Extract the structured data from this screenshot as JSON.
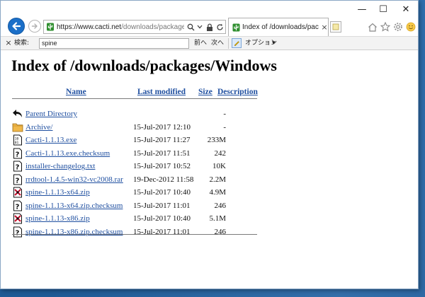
{
  "browser": {
    "window_controls": {
      "minimize": "—",
      "maximize": "☐",
      "close": "✕"
    },
    "address_bar": {
      "url_prefix": "https://www.cacti.net",
      "url_rest": "/downloads/packages/Wind",
      "search_icon": "search-icon",
      "dropdown_icon": "chevron-down-icon",
      "lock_icon": "lock-icon",
      "refresh_icon": "refresh-icon"
    },
    "tab": {
      "title": "Index of /downloads/packa...",
      "close": "×"
    },
    "toolbar_icons": [
      "home-icon",
      "star-icon",
      "gear-icon",
      "smiley-icon"
    ],
    "find_bar": {
      "close": "×",
      "label": "検索:",
      "value": "spine",
      "prev": "前へ",
      "next": "次へ",
      "options": "オプション",
      "options_arrow": "▾"
    }
  },
  "page": {
    "title": "Index of /downloads/packages/Windows",
    "columns": {
      "name": "Name",
      "modified": "Last modified",
      "size": "Size",
      "description": "Description"
    },
    "rows": [
      {
        "icon": "back-arrow-icon",
        "name": "Parent Directory",
        "date": "",
        "size": "-"
      },
      {
        "icon": "folder-icon",
        "name": "Archive/",
        "date": "15-Jul-2017 12:10",
        "size": "-"
      },
      {
        "icon": "binary-file-icon",
        "name": "Cacti-1.1.13.exe",
        "date": "15-Jul-2017 11:27",
        "size": "233M"
      },
      {
        "icon": "unknown-file-icon",
        "name": "Cacti-1.1.13.exe.checksum",
        "date": "15-Jul-2017 11:51",
        "size": "242"
      },
      {
        "icon": "unknown-file-icon",
        "name": "installer-changelog.txt",
        "date": "15-Jul-2017 10:52",
        "size": "10K"
      },
      {
        "icon": "unknown-file-icon",
        "name": "rrdtool-1.4.5-win32-vc2008.rar",
        "date": "19-Dec-2012 11:58",
        "size": "2.2M"
      },
      {
        "icon": "compressed-file-icon",
        "name": "spine-1.1.13-x64.zip",
        "date": "15-Jul-2017 10:40",
        "size": "4.9M"
      },
      {
        "icon": "unknown-file-icon",
        "name": "spine-1.1.13-x64.zip.checksum",
        "date": "15-Jul-2017 11:01",
        "size": "246"
      },
      {
        "icon": "compressed-file-icon",
        "name": "spine-1.1.13-x86.zip",
        "date": "15-Jul-2017 10:40",
        "size": "5.1M"
      },
      {
        "icon": "unknown-file-icon",
        "name": "spine-1.1.13-x86.zip.checksum",
        "date": "15-Jul-2017 11:01",
        "size": "246"
      }
    ]
  },
  "colors": {
    "link": "#1f4fa0",
    "back_button": "#1b6fc8",
    "desktop": "#2a67a4"
  }
}
